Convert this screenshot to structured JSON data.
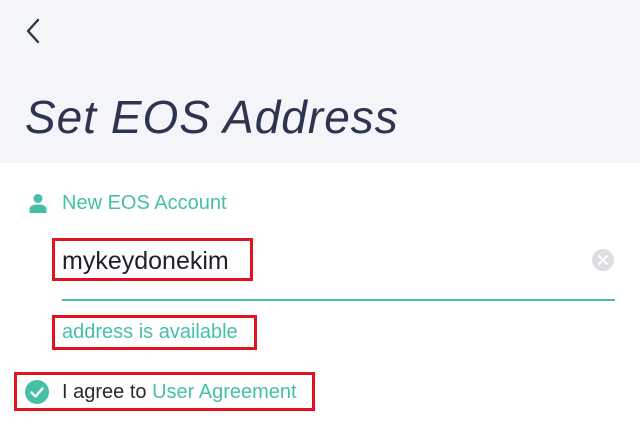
{
  "colors": {
    "accent": "#45c0a6",
    "title": "#2d3450",
    "header_bg": "#f4f5f8",
    "highlight": "#e0141e",
    "clear_icon": "#dcdee3"
  },
  "header": {
    "back_icon": "chevron-left-icon",
    "title": "Set EOS Address"
  },
  "account_section": {
    "icon": "user-icon",
    "label": "New EOS Account"
  },
  "account_input": {
    "value": "mykeydonekim",
    "clear_icon": "clear-circle-icon"
  },
  "status": {
    "text": "address is available"
  },
  "agreement": {
    "checked": true,
    "check_icon": "check-circle-icon",
    "prefix": "I agree to ",
    "link_text": "User Agreement"
  }
}
